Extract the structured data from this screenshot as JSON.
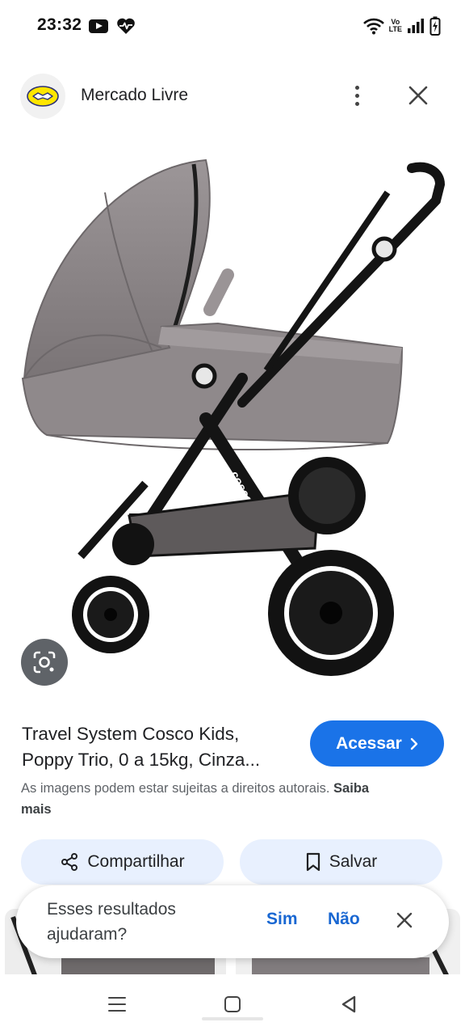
{
  "status_bar": {
    "time": "23:32",
    "volte_line1": "Vo",
    "volte_line2": "LTE",
    "icons": [
      "youtube-icon",
      "health-heart-icon",
      "wifi-icon",
      "volte-icon",
      "signal-icon",
      "battery-charging-icon"
    ]
  },
  "header": {
    "site_name": "Mercado Livre",
    "logo_icon": "mercado-livre-handshake-logo",
    "more_icon": "more-vertical-icon",
    "close_icon": "close-icon"
  },
  "image": {
    "brand_text": "cosco",
    "lens_icon": "google-lens-icon",
    "colors": {
      "fabric": "#8c8688",
      "frame": "#141414"
    }
  },
  "product": {
    "title_line1": "Travel System Cosco Kids,",
    "title_line2": "Poppy Trio, 0 a 15kg, Cinza...",
    "visit_label": "Acessar",
    "copyright_text": "As imagens podem estar sujeitas a direitos autorais.",
    "learn_more_line1": "Saiba",
    "learn_more_line2": "mais"
  },
  "actions": {
    "share_label": "Compartilhar",
    "save_label": "Salvar"
  },
  "feedback": {
    "question_line1": "Esses resultados",
    "question_line2": "ajudaram?",
    "yes_label": "Sim",
    "no_label": "Não"
  },
  "colors": {
    "accent_blue": "#1a73e8",
    "chip_bg": "#e8f0fe",
    "link_blue": "#1967d2"
  }
}
